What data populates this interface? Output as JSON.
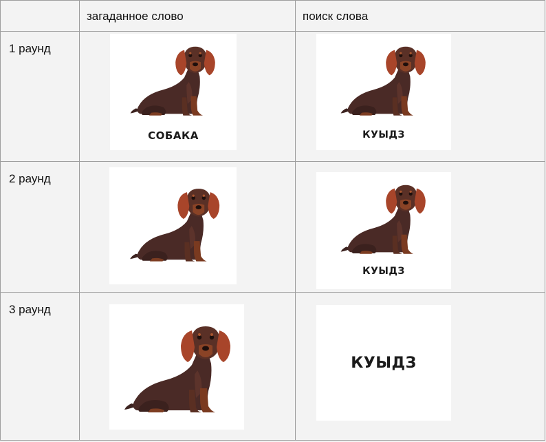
{
  "table": {
    "header": {
      "col1": "",
      "col2": "загаданное слово",
      "col3": "поиск слова"
    },
    "rows": [
      {
        "label": "1 раунд",
        "left_caption": "СОБАКА",
        "right_caption": "КУЫДЗ"
      },
      {
        "label": "2 раунд",
        "left_caption": "",
        "right_caption": "КУЫДЗ"
      },
      {
        "label": "3 раунд",
        "left_caption": "",
        "right_caption": "КУЫДЗ"
      }
    ]
  },
  "colors": {
    "dog_body": "#4a2a26",
    "dog_ears": "#a8452a",
    "dog_tan": "#8a4326",
    "table_bg": "#f3f3f3",
    "border": "#9e9e9e"
  },
  "icons": [
    "dachshund-illustration"
  ]
}
